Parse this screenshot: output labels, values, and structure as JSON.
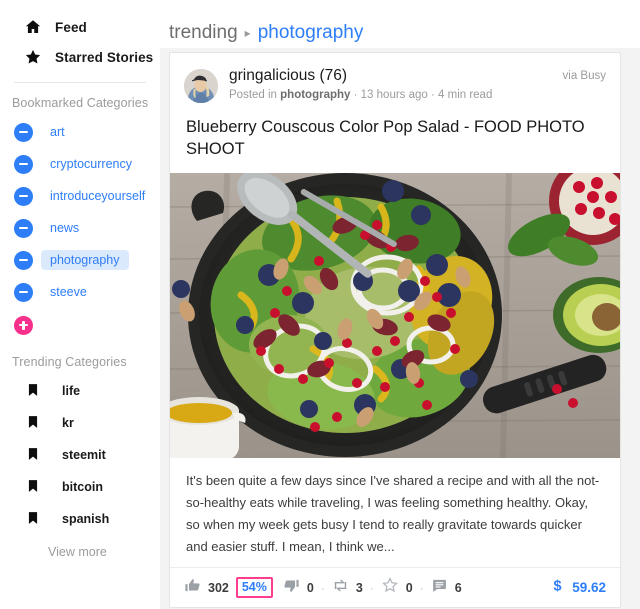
{
  "sidebar": {
    "nav": [
      {
        "label": "Feed",
        "icon": "home-icon"
      },
      {
        "label": "Starred Stories",
        "icon": "star-icon"
      }
    ],
    "bookmarked_title": "Bookmarked Categories",
    "bookmarked": [
      {
        "label": "art",
        "icon": "minus-circle-icon",
        "active": false
      },
      {
        "label": "cryptocurrency",
        "icon": "minus-circle-icon",
        "active": false
      },
      {
        "label": "introduceyourself",
        "icon": "minus-circle-icon",
        "active": false
      },
      {
        "label": "news",
        "icon": "minus-circle-icon",
        "active": false
      },
      {
        "label": "photography",
        "icon": "minus-circle-icon",
        "active": true
      },
      {
        "label": "steeve",
        "icon": "minus-circle-icon",
        "active": false
      }
    ],
    "add_icon": "plus-circle-icon",
    "trending_title": "Trending Categories",
    "trending": [
      {
        "label": "life",
        "icon": "bookmark-icon"
      },
      {
        "label": "kr",
        "icon": "bookmark-icon"
      },
      {
        "label": "steemit",
        "icon": "bookmark-icon"
      },
      {
        "label": "bitcoin",
        "icon": "bookmark-icon"
      },
      {
        "label": "spanish",
        "icon": "bookmark-icon"
      }
    ],
    "view_more": "View more"
  },
  "breadcrumb": {
    "root": "trending",
    "separator": "▸",
    "current": "photography"
  },
  "post": {
    "author": "gringalicious (76)",
    "avatar_icon": "user-avatar",
    "via": "via Busy",
    "meta_prefix": "Posted in",
    "meta_category": "photography",
    "meta_suffix": "· 13 hours ago · 4 min read",
    "title": "Blueberry Couscous Color Pop Salad - FOOD PHOTO SHOOT",
    "image_alt": "salad-photo",
    "excerpt": "It's been quite a few days since I've shared a recipe and with all the not-so-healthy eats while traveling, I was feeling something healthy. Okay, so when my week gets busy I tend to really gravitate towards quicker and easier stuff. I mean, I think we...",
    "actions": {
      "upvote_icon": "thumbs-up-icon",
      "upvote_count": "302",
      "percent": "54%",
      "downvote_icon": "thumbs-down-icon",
      "downvote_count": "0",
      "resteem_icon": "resteem-icon",
      "resteem_count": "3",
      "favorite_icon": "star-outline-icon",
      "favorite_count": "0",
      "comment_icon": "comment-icon",
      "comment_count": "6",
      "separator": "·",
      "payout_icon": "dollar-icon",
      "payout_amount": "59.62"
    }
  },
  "colors": {
    "accent_blue": "#2e7ef8",
    "accent_pink": "#f7308c",
    "highlight_pink": "#ff3d8f",
    "active_bg": "#dbe9fd",
    "muted": "#9b9b9b"
  }
}
